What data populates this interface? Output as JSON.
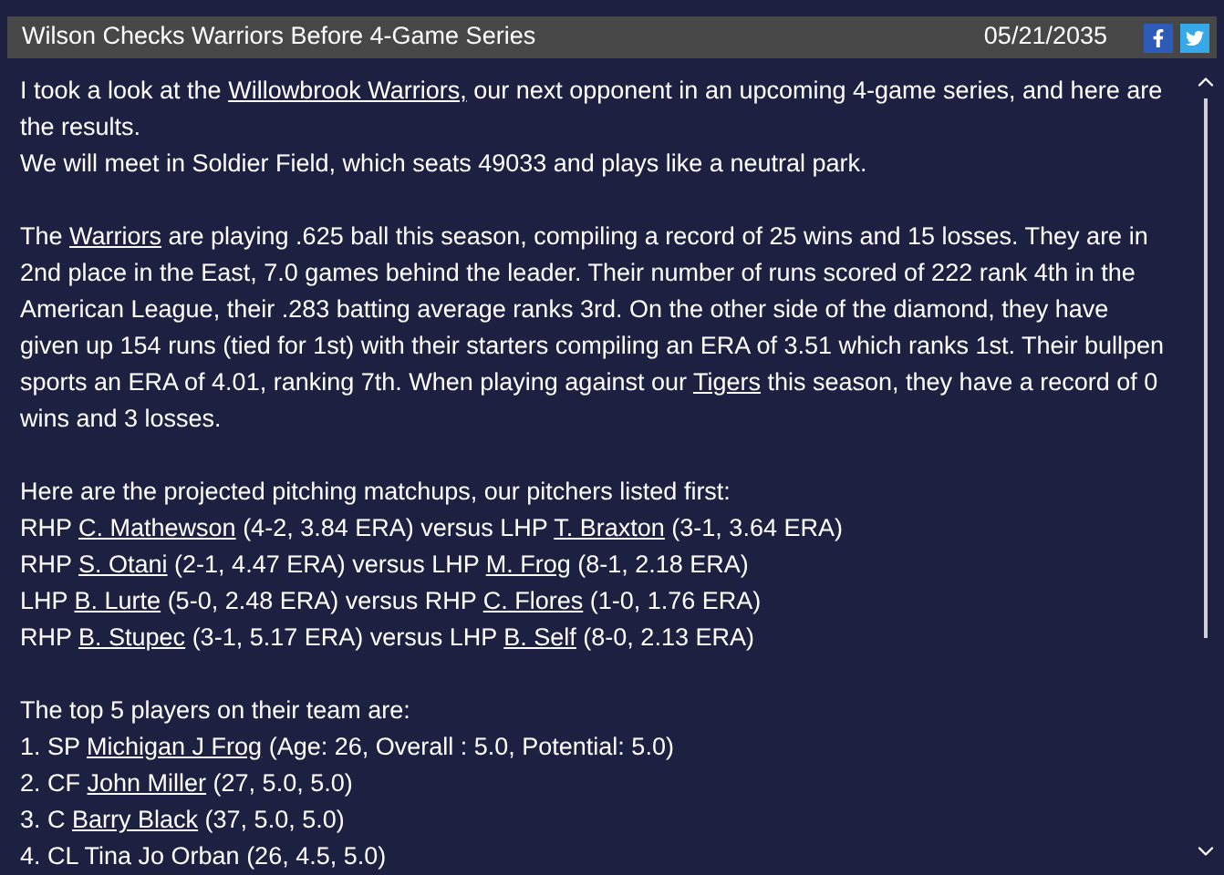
{
  "header": {
    "title": "Wilson Checks Warriors Before 4-Game Series",
    "date": "05/21/2035"
  },
  "blocks": [
    [
      [
        {
          "text": "I took a look at the "
        },
        {
          "text": "Willowbrook Warriors,",
          "link": true
        },
        {
          "text": " our next opponent in an upcoming 4-game series, and here are the results."
        }
      ],
      [
        {
          "text": "We will meet in Soldier Field, which seats 49033 and plays like a neutral park."
        }
      ]
    ],
    [
      [
        {
          "text": "The "
        },
        {
          "text": "Warriors",
          "link": true
        },
        {
          "text": " are playing .625 ball this season, compiling a record of 25 wins and 15 losses. They are in 2nd place in the East, 7.0 games behind the leader. Their number of runs scored of 222 rank 4th in the American League, their .283 batting average ranks 3rd. On the other side of the diamond, they have given up 154 runs (tied for 1st) with their starters compiling an ERA of 3.51 which ranks 1st. Their bullpen sports an ERA of 4.01, ranking 7th. When playing against our "
        },
        {
          "text": "Tigers",
          "link": true
        },
        {
          "text": " this season, they have a record of 0 wins and 3 losses."
        }
      ]
    ],
    [
      [
        {
          "text": "Here are the projected pitching matchups, our pitchers listed first:"
        }
      ],
      [
        {
          "text": "RHP "
        },
        {
          "text": "C. Mathewson",
          "link": true
        },
        {
          "text": " (4-2, 3.84 ERA) versus LHP "
        },
        {
          "text": "T. Braxton",
          "link": true
        },
        {
          "text": " (3-1, 3.64 ERA)"
        }
      ],
      [
        {
          "text": "RHP "
        },
        {
          "text": "S. Otani",
          "link": true
        },
        {
          "text": " (2-1, 4.47 ERA) versus LHP "
        },
        {
          "text": "M. Frog",
          "link": true
        },
        {
          "text": " (8-1, 2.18 ERA)"
        }
      ],
      [
        {
          "text": "LHP "
        },
        {
          "text": "B. Lurte",
          "link": true
        },
        {
          "text": " (5-0, 2.48 ERA) versus RHP "
        },
        {
          "text": "C. Flores",
          "link": true
        },
        {
          "text": " (1-0, 1.76 ERA)"
        }
      ],
      [
        {
          "text": "RHP "
        },
        {
          "text": "B. Stupec",
          "link": true
        },
        {
          "text": " (3-1, 5.17 ERA) versus LHP "
        },
        {
          "text": "B. Self",
          "link": true
        },
        {
          "text": " (8-0, 2.13 ERA)"
        }
      ]
    ],
    [
      [
        {
          "text": "The top 5 players on their team are:"
        }
      ],
      [
        {
          "text": "1. SP "
        },
        {
          "text": "Michigan J Frog",
          "link": true
        },
        {
          "text": " (Age: 26, Overall : 5.0, Potential: 5.0)"
        }
      ],
      [
        {
          "text": "2. CF "
        },
        {
          "text": "John Miller",
          "link": true
        },
        {
          "text": " (27, 5.0, 5.0)"
        }
      ],
      [
        {
          "text": "3. C "
        },
        {
          "text": "Barry Black",
          "link": true
        },
        {
          "text": " (37, 5.0, 5.0)"
        }
      ],
      [
        {
          "text": "4. CL Tina Jo Orban (26, 4.5, 5.0)"
        }
      ]
    ]
  ]
}
